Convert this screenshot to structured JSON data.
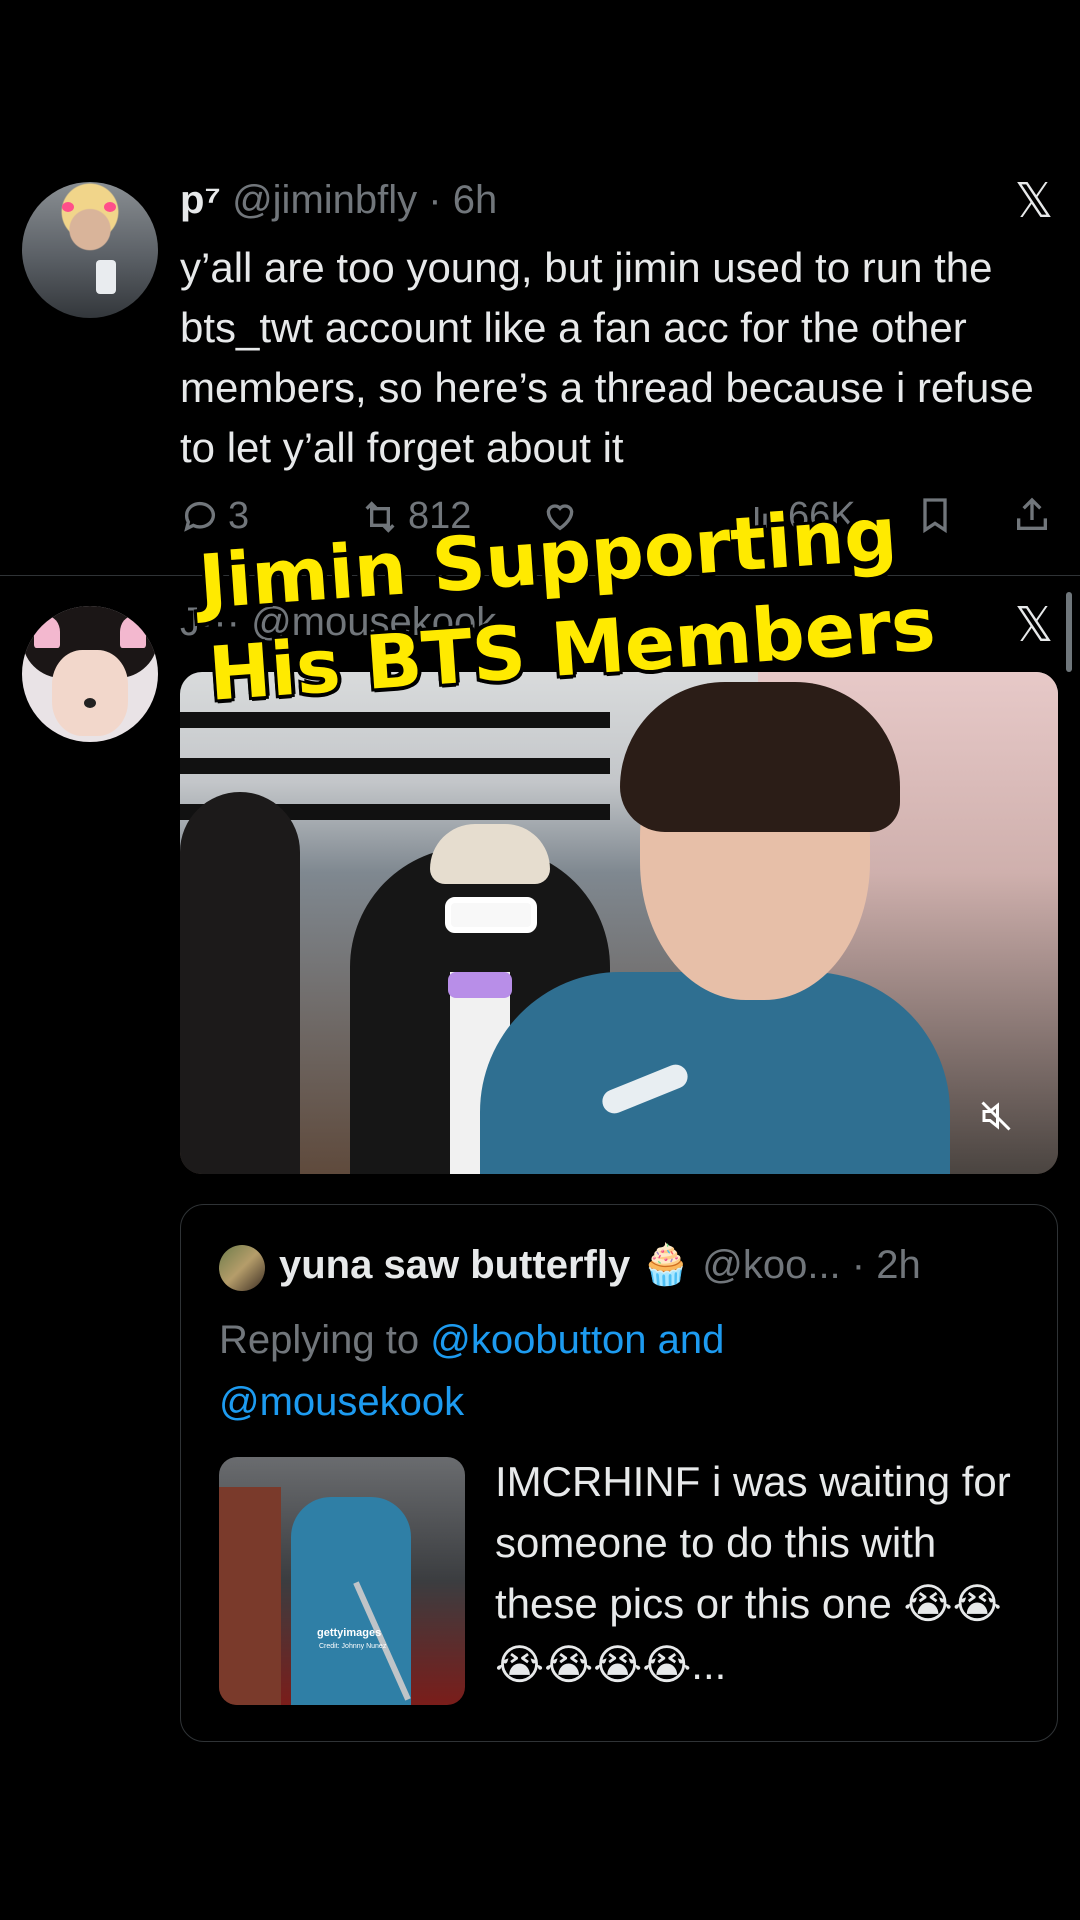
{
  "tweet1": {
    "display_name": "p⁷",
    "handle": "@jiminbfly",
    "time": "· 6h",
    "body": "y’all are too young, but jimin used to run the bts_twt account like a fan acc for the other members, so here’s a thread because i refuse to let y’all forget about it",
    "replies": "3",
    "retweets": "812",
    "views": "66K",
    "icons": [
      "reply-icon",
      "retweet-icon",
      "like-icon",
      "views-icon",
      "bookmark-icon",
      "share-icon",
      "x-logo-icon"
    ]
  },
  "tweet2": {
    "header_partial": "J··· @mousekook"
  },
  "overlay": {
    "line1": "Jimin Supporting",
    "line2": "His BTS Members",
    "color": "#ffea00"
  },
  "quote": {
    "display_name": "yuna saw butterfly 🧁",
    "handle": "@koo... · 2h",
    "replying_prefix": "Replying to ",
    "mention1": "@koobutton and",
    "mention2": "@mousekook",
    "body": "IMCRHINF i was waiting for someone to do this with these pics or this one 😭😭😭😭😭😭...",
    "image_watermark": "gettyimages",
    "image_credit": "Credit: Johnny Nunez"
  },
  "colors": {
    "background": "#000000",
    "text": "#e7e9ea",
    "muted": "#71767b",
    "link": "#1d9bf0",
    "border": "#2f3336"
  }
}
